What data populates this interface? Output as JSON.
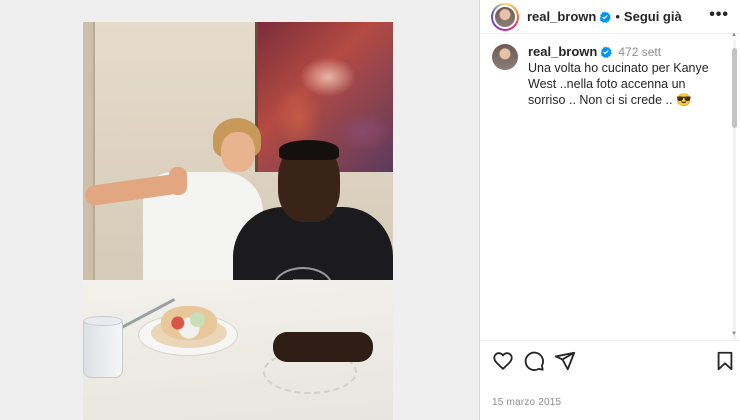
{
  "post": {
    "username": "real_brown",
    "follow_label": "Segui già",
    "separator": "•",
    "more_label": "•••",
    "caption": {
      "username": "real_brown",
      "time": "472 sett",
      "text": "Una volta ho cucinato per Kanye West ..nella foto accenna un sorriso .. Non ci si crede .. 😎"
    },
    "date": "15 marzo 2015"
  },
  "icons": {
    "verified": "verified-badge-icon",
    "like": "heart-icon",
    "comment": "comment-icon",
    "share": "send-icon",
    "save": "bookmark-icon",
    "more": "more-horizontal-icon"
  },
  "colors": {
    "verified_blue": "#0095f6",
    "text": "#262626",
    "secondary_text": "#8e8e8e",
    "border": "#dbdbdb"
  }
}
